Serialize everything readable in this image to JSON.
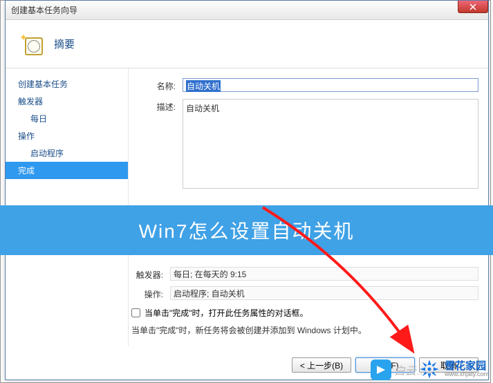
{
  "window": {
    "title": "创建基本任务向导",
    "page_title": "摘要",
    "close_icon": "close"
  },
  "sidebar": {
    "items": [
      {
        "label": "创建基本任务",
        "sub": false
      },
      {
        "label": "触发器",
        "sub": false
      },
      {
        "label": "每日",
        "sub": true
      },
      {
        "label": "操作",
        "sub": false
      },
      {
        "label": "启动程序",
        "sub": true
      },
      {
        "label": "完成",
        "sub": false,
        "selected": true
      }
    ]
  },
  "form": {
    "name_label": "名称:",
    "name_value": "自动关机",
    "desc_label": "描述:",
    "desc_value": "自动关机",
    "trigger_label": "触发器:",
    "trigger_value": "每日; 在每天的 9:15",
    "action_label": "操作:",
    "action_value": "启动程序; 自动关机",
    "checkbox_label": "当单击\"完成\"时，打开此任务属性的对话框。",
    "hint_text": "当单击\"完成\"时，新任务将会被创建并添加到 Windows 计划中。"
  },
  "buttons": {
    "back": "< 上一步(B)",
    "finish": "完成(F)",
    "cancel": "取消"
  },
  "overlay": {
    "banner_text": "Win7怎么设置自动关机"
  },
  "watermarks": {
    "brand2_cn": "雪花家园",
    "brand2_url": "www.xhjaty.com"
  }
}
